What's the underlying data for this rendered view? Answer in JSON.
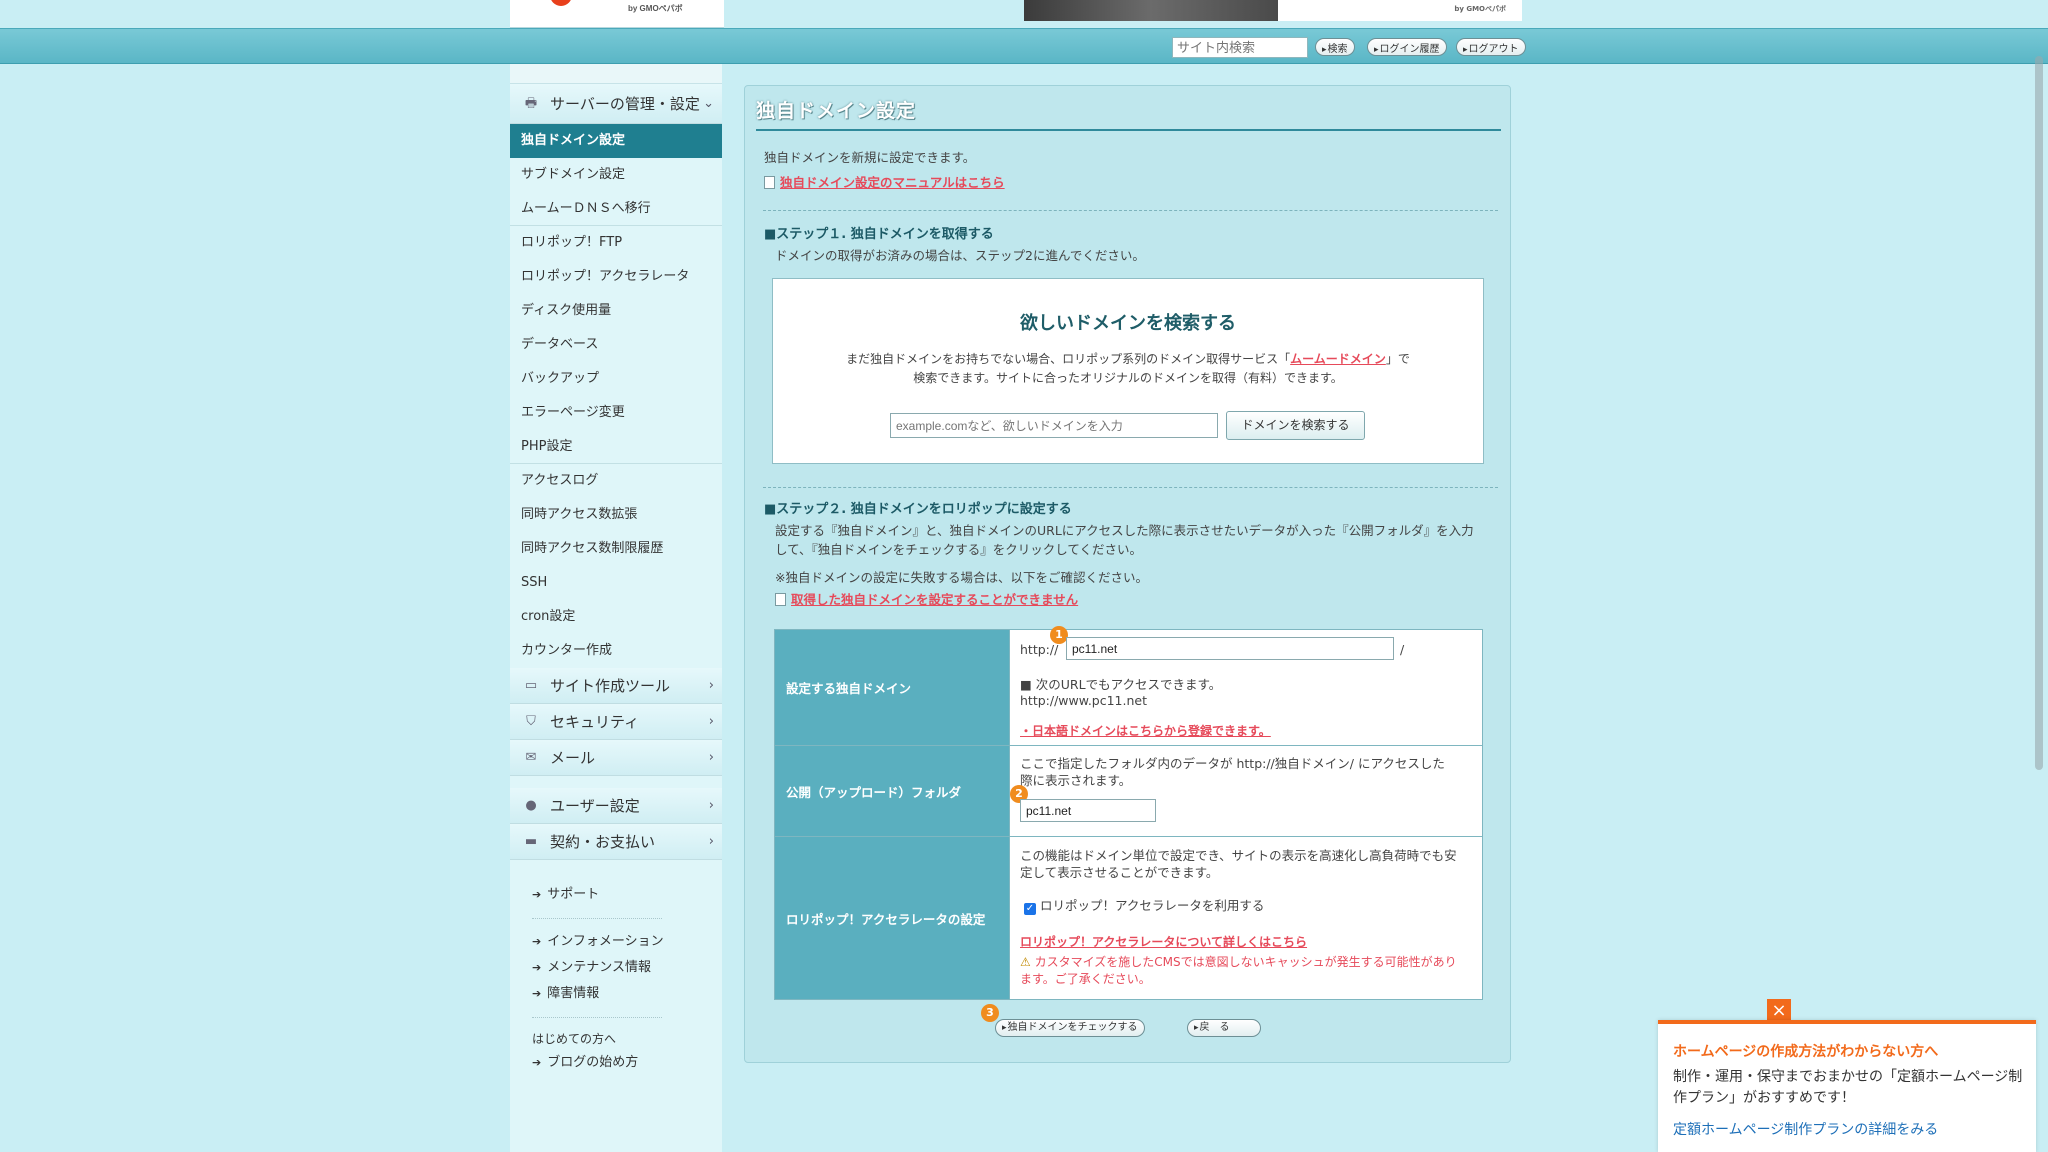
{
  "header": {
    "logo_sub": "by GMOペパボ",
    "banner_sub": "by GMOペパボ",
    "site_search_placeholder": "サイト内検索",
    "search_btn": "検索",
    "login_history_btn": "ログイン履歴",
    "logout_btn": "ログアウト"
  },
  "sidebar": {
    "category_server": "サーバーの管理・設定",
    "items": [
      "独自ドメイン設定",
      "サブドメイン設定",
      "ムームーＤＮＳへ移行",
      "ロリポップ！FTP",
      "ロリポップ！アクセラレータ",
      "ディスク使用量",
      "データベース",
      "バックアップ",
      "エラーページ変更",
      "PHP設定",
      "アクセスログ",
      "同時アクセス数拡張",
      "同時アクセス数制限履歴",
      "SSH",
      "cron設定",
      "カウンター作成"
    ],
    "category_site_tools": "サイト作成ツール",
    "category_security": "セキュリティ",
    "category_mail": "メール",
    "category_user": "ユーザー設定",
    "category_billing": "契約・お支払い",
    "support": "サポート",
    "information": "インフォメーション",
    "maintenance": "メンテナンス情報",
    "outage": "障害情報",
    "first_time": "はじめての方へ",
    "blog_start": "ブログの始め方"
  },
  "main": {
    "title": "独自ドメイン設定",
    "intro": "独自ドメインを新規に設定できます。",
    "manual_link": "独自ドメイン設定のマニュアルはこちら",
    "step1_title": "■ステップ１. 独自ドメインを取得する",
    "step1_desc": "ドメインの取得がお済みの場合は、ステップ2に進んでください。",
    "search_title": "欲しいドメインを検索する",
    "search_desc_1": "まだ独自ドメインをお持ちでない場合、ロリポップ系列のドメイン取得サービス「",
    "search_desc_link": "ムームードメイン",
    "search_desc_2": "」で",
    "search_desc_3": "検索できます。サイトに合ったオリジナルのドメインを取得（有料）できます。",
    "search_placeholder": "example.comなど、欲しいドメインを入力",
    "search_button": "ドメインを検索する",
    "step2_title": "■ステップ２. 独自ドメインをロリポップに設定する",
    "step2_desc_1": "設定する『独自ドメイン』と、独自ドメインのURLにアクセスした際に表示させたいデータが入った『公開フォルダ』を入力",
    "step2_desc_2": "して、『独自ドメインをチェックする』をクリックしてください。",
    "step2_note": "※独自ドメインの設定に失敗する場合は、以下をご確認ください。",
    "step2_link": "取得した独自ドメインを設定することができません",
    "row1_label": "設定する独自ドメイン",
    "row1_prefix": "http://",
    "row1_value": "pc11.net",
    "row1_suffix": "/",
    "row1_note": "■ 次のURLでもアクセスできます。",
    "row1_alt_url": "http://www.pc11.net",
    "row1_link": "・日本語ドメインはこちらから登録できます。",
    "row2_label": "公開（アップロード）フォルダ",
    "row2_desc_1": "ここで指定したフォルダ内のデータが http://独自ドメイン/ にアクセスした",
    "row2_desc_2": "際に表示されます。",
    "row2_value": "pc11.net",
    "row3_label": "ロリポップ！アクセラレータの設定",
    "row3_desc_1": "この機能はドメイン単位で設定でき、サイトの表示を高速化し高負荷時でも安",
    "row3_desc_2": "定して表示させることができます。",
    "row3_checkbox_label": "ロリポップ！アクセラレータを利用する",
    "row3_link": "ロリポップ！アクセラレータについて詳しくはこちら",
    "row3_warn": "カスタマイズを施したCMSでは意図しないキャッシュが発生する可能性があります。ご了承ください。",
    "check_button": "独自ドメインをチェックする",
    "back_button": "戻　る",
    "badges": [
      "1",
      "2",
      "3"
    ]
  },
  "popup": {
    "title": "ホームページの作成方法がわからない方へ",
    "body": "制作・運用・保守までおまかせの「定額ホームページ制作プラン」がおすすめです！",
    "link": "定額ホームページ制作プランの詳細をみる"
  },
  "colors": {
    "accent": "#1f7f90",
    "link": "#e64a5a",
    "badge": "#f08c1e",
    "popup_accent": "#f26a1b"
  }
}
